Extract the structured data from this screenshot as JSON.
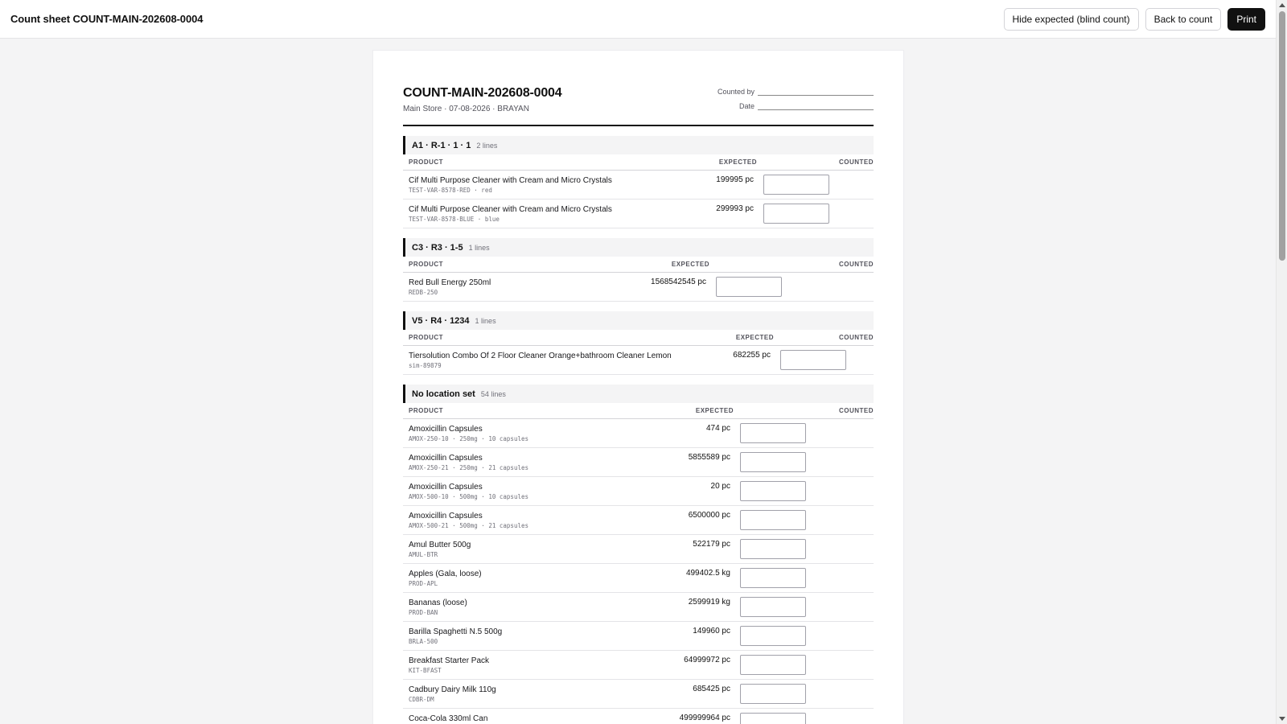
{
  "topbar": {
    "title": "Count sheet COUNT-MAIN-202608-0004",
    "hide_expected": "Hide expected (blind count)",
    "back": "Back to count",
    "print": "Print"
  },
  "sheet": {
    "title": "COUNT-MAIN-202608-0004",
    "subtitle": "Main Store · 07-08-2026 · BRAYAN",
    "counted_by_label": "Counted by",
    "date_label": "Date",
    "col_product": "PRODUCT",
    "col_expected": "EXPECTED",
    "col_counted": "COUNTED"
  },
  "groups": [
    {
      "title": "A1 · R-1 · 1 · 1",
      "count": "2 lines",
      "items": [
        {
          "name": "Cif Multi Purpose Cleaner with Cream and Micro Crystals",
          "sku": "TEST-VAR-8578-RED · red",
          "expected": "199995 pc"
        },
        {
          "name": "Cif Multi Purpose Cleaner with Cream and Micro Crystals",
          "sku": "TEST-VAR-8578-BLUE · blue",
          "expected": "299993 pc"
        }
      ]
    },
    {
      "title": "C3 · R3 · 1-5",
      "count": "1 lines",
      "items": [
        {
          "name": "Red Bull Energy 250ml",
          "sku": "REDB-250",
          "expected": "1568542545 pc"
        }
      ]
    },
    {
      "title": "V5 · R4 · 1234",
      "count": "1 lines",
      "items": [
        {
          "name": "Tiersolution Combo Of 2 Floor Cleaner Orange+bathroom Cleaner Lemon",
          "sku": "sim-89879",
          "expected": "682255 pc"
        }
      ]
    },
    {
      "title": "No location set",
      "count": "54 lines",
      "items": [
        {
          "name": "Amoxicillin Capsules",
          "sku": "AMOX-250-10 · 250mg · 10 capsules",
          "expected": "474 pc"
        },
        {
          "name": "Amoxicillin Capsules",
          "sku": "AMOX-250-21 · 250mg · 21 capsules",
          "expected": "5855589 pc"
        },
        {
          "name": "Amoxicillin Capsules",
          "sku": "AMOX-500-10 · 500mg · 10 capsules",
          "expected": "20 pc"
        },
        {
          "name": "Amoxicillin Capsules",
          "sku": "AMOX-500-21 · 500mg · 21 capsules",
          "expected": "6500000 pc"
        },
        {
          "name": "Amul Butter 500g",
          "sku": "AMUL-BTR",
          "expected": "522179 pc"
        },
        {
          "name": "Apples (Gala, loose)",
          "sku": "PROD-APL",
          "expected": "499402.5 kg"
        },
        {
          "name": "Bananas (loose)",
          "sku": "PROD-BAN",
          "expected": "2599919 kg"
        },
        {
          "name": "Barilla Spaghetti N.5 500g",
          "sku": "BRLA-500",
          "expected": "149960 pc"
        },
        {
          "name": "Breakfast Starter Pack",
          "sku": "KIT-BFAST",
          "expected": "64999972 pc"
        },
        {
          "name": "Cadbury Dairy Milk 110g",
          "sku": "CDBR-DM",
          "expected": "685425 pc"
        },
        {
          "name": "Coca-Cola 330ml Can",
          "sku": "COKE-330",
          "expected": "499999964 pc"
        }
      ]
    }
  ]
}
